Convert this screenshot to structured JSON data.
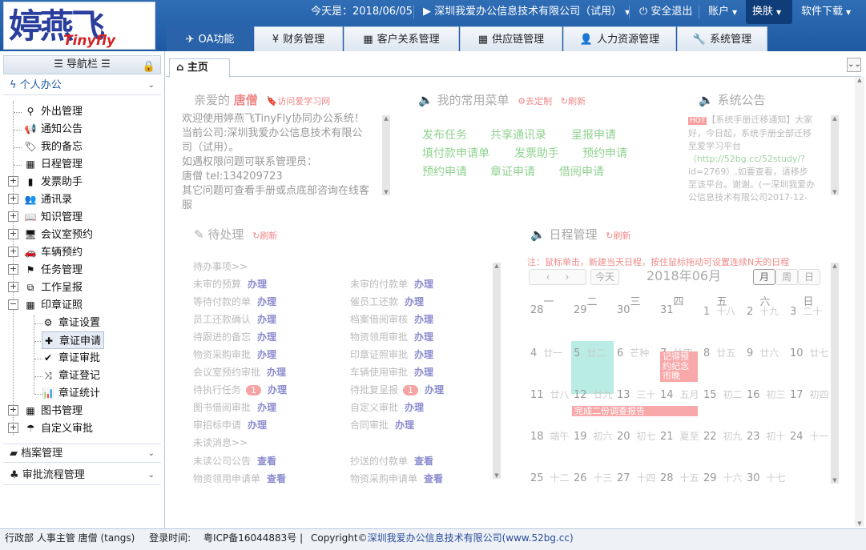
{
  "logo": {
    "cn": "婷燕飞",
    "en": "Tinyfly"
  },
  "topbar": {
    "date": "今天是：2018/06/05",
    "company": "▶ 深圳我爱办公信息技术有限公司（试用）",
    "logout": "安全退出",
    "account": "账户",
    "skin": "换肤",
    "download": "软件下载"
  },
  "modules": [
    {
      "label": "OA功能",
      "icon": "paper-plane-icon"
    },
    {
      "label": "财务管理",
      "icon": "yen-icon"
    },
    {
      "label": "客户关系管理",
      "icon": "table-icon"
    },
    {
      "label": "供应链管理",
      "icon": "table-icon"
    },
    {
      "label": "人力资源管理",
      "icon": "user-icon"
    },
    {
      "label": "系统管理",
      "icon": "wrench-icon"
    }
  ],
  "sidebar": {
    "title": "导航栏",
    "groups": [
      "个人办公",
      "档案管理",
      "审批流程管理"
    ],
    "items": [
      "外出管理",
      "通知公告",
      "我的备忘",
      "日程管理",
      "发票助手",
      "通讯录",
      "知识管理",
      "会议室预约",
      "车辆预约",
      "任务管理",
      "工作呈报",
      "印章证照"
    ],
    "subitems": [
      "章证设置",
      "章证申请",
      "章证审批",
      "章证登记",
      "章证统计"
    ],
    "after": [
      "图书管理",
      "自定义审批"
    ]
  },
  "main": {
    "hometab": "主页",
    "greet": {
      "prefix": "亲爱的",
      "user": "唐僧",
      "link": "访问爱学习网"
    },
    "welcome": [
      "欢迎使用婷燕飞TinyFly协同办公系统！",
      "当前公司:深圳我爱办公信息技术有限公",
      "司（试用）。",
      "如遇权限问题可联系管理员：",
      "唐僧 tel:134209723",
      "其它问题可查看手册或点底部咨询在线客",
      "服"
    ],
    "menu": {
      "title": "我的常用菜单",
      "custom": "去定制",
      "refresh": "刷新",
      "links": [
        "发布任务",
        "共享通讯录",
        "呈报申请",
        "填付款申请单",
        "发票助手",
        "预约申请",
        "预约申请",
        "章证申请",
        "借阅申请"
      ]
    },
    "notice": {
      "title": "系统公告",
      "hot": "HOT",
      "lines": [
        "【系统手册迁移通知】大家",
        "好，今日起，系统手册全部迁移",
        "至爱学习平台",
        "（http://52bg.cc/52study/?",
        "id=2769）,如要查看，请移步",
        "至该平台。谢谢。(一深圳我爱办",
        "公信息技术有限公司2017-12-"
      ]
    },
    "todo": {
      "title": "待处理",
      "refresh": "刷新",
      "section1": "待办事项>>",
      "section2": "未读消息>>",
      "left": [
        [
          "未审的预算",
          "办理",
          ""
        ],
        [
          "等待付款的单",
          "办理",
          ""
        ],
        [
          "员工还款确认",
          "办理",
          ""
        ],
        [
          "待跟进的备忘",
          "办理",
          ""
        ],
        [
          "物资采购审批",
          "办理",
          ""
        ],
        [
          "会议室预约审批",
          "办理",
          ""
        ],
        [
          "待执行任务",
          "办理",
          "1"
        ],
        [
          "图书借阅审批",
          "办理",
          ""
        ],
        [
          "审招标申请",
          "办理",
          ""
        ]
      ],
      "right": [
        [
          "未审的付款单",
          "办理",
          ""
        ],
        [
          "催员工还款",
          "办理",
          ""
        ],
        [
          "档案借阅审核",
          "办理",
          ""
        ],
        [
          "物资领用审批",
          "办理",
          ""
        ],
        [
          "印章证照审批",
          "办理",
          ""
        ],
        [
          "车辆使用审批",
          "办理",
          ""
        ],
        [
          "待批复呈报",
          "办理",
          "1"
        ],
        [
          "自定义审批",
          "办理",
          ""
        ],
        [
          "合同审批",
          "办理",
          ""
        ]
      ],
      "msgs_left": [
        [
          "未读公司公告",
          "查看"
        ],
        [
          "物资领用申请单",
          "查看"
        ]
      ],
      "msgs_right": [
        [
          "抄送的付款单",
          "查看"
        ],
        [
          "物资采购申请单",
          "查看"
        ]
      ]
    },
    "cal": {
      "title": "日程管理",
      "refresh": "刷新",
      "note": "注：鼠标单击，新建当天日程，按住鼠标拖动可设置连续N天的日程",
      "today": "今天",
      "month": "2018年06月",
      "views": [
        "月",
        "周",
        "日"
      ],
      "weekdays": [
        "一",
        "二",
        "三",
        "四",
        "五",
        "六",
        "日"
      ],
      "rows": [
        [
          [
            "28",
            ""
          ],
          [
            "29",
            ""
          ],
          [
            "30",
            ""
          ],
          [
            "31",
            ""
          ],
          [
            "1",
            "十八"
          ],
          [
            "2",
            "十九"
          ],
          [
            "3",
            "二十"
          ]
        ],
        [
          [
            "4",
            "廿一"
          ],
          [
            "5",
            "廿二"
          ],
          [
            "6",
            "芒种"
          ],
          [
            "7",
            "廿四"
          ],
          [
            "8",
            "廿五"
          ],
          [
            "9",
            "廿六"
          ],
          [
            "10",
            "廿七"
          ]
        ],
        [
          [
            "11",
            "廿八"
          ],
          [
            "12",
            "廿九"
          ],
          [
            "13",
            "三十"
          ],
          [
            "14",
            "五月"
          ],
          [
            "15",
            "初二"
          ],
          [
            "16",
            "初三"
          ],
          [
            "17",
            "初四"
          ]
        ],
        [
          [
            "18",
            "端午"
          ],
          [
            "19",
            "初六"
          ],
          [
            "20",
            "初七"
          ],
          [
            "21",
            "夏至"
          ],
          [
            "22",
            "初九"
          ],
          [
            "23",
            "初十"
          ],
          [
            "24",
            "十一"
          ]
        ],
        [
          [
            "25",
            "十二"
          ],
          [
            "26",
            "十三"
          ],
          [
            "27",
            "十四"
          ],
          [
            "28",
            "十五"
          ],
          [
            "29",
            "十六"
          ],
          [
            "30",
            "十七"
          ],
          [
            "",
            ""
          ]
        ]
      ],
      "events": [
        "记得预约纪念市晚",
        "完成二份调查报告"
      ]
    }
  },
  "footer": {
    "dept": "行政部 人事主管 唐僧 (tangs)",
    "login": "登录时间:",
    "icp": "粤ICP备16044883号 |",
    "copy": "Copyright©",
    "company": "深圳我爱办公信息技术有限公司(www.52bg.cc)"
  }
}
